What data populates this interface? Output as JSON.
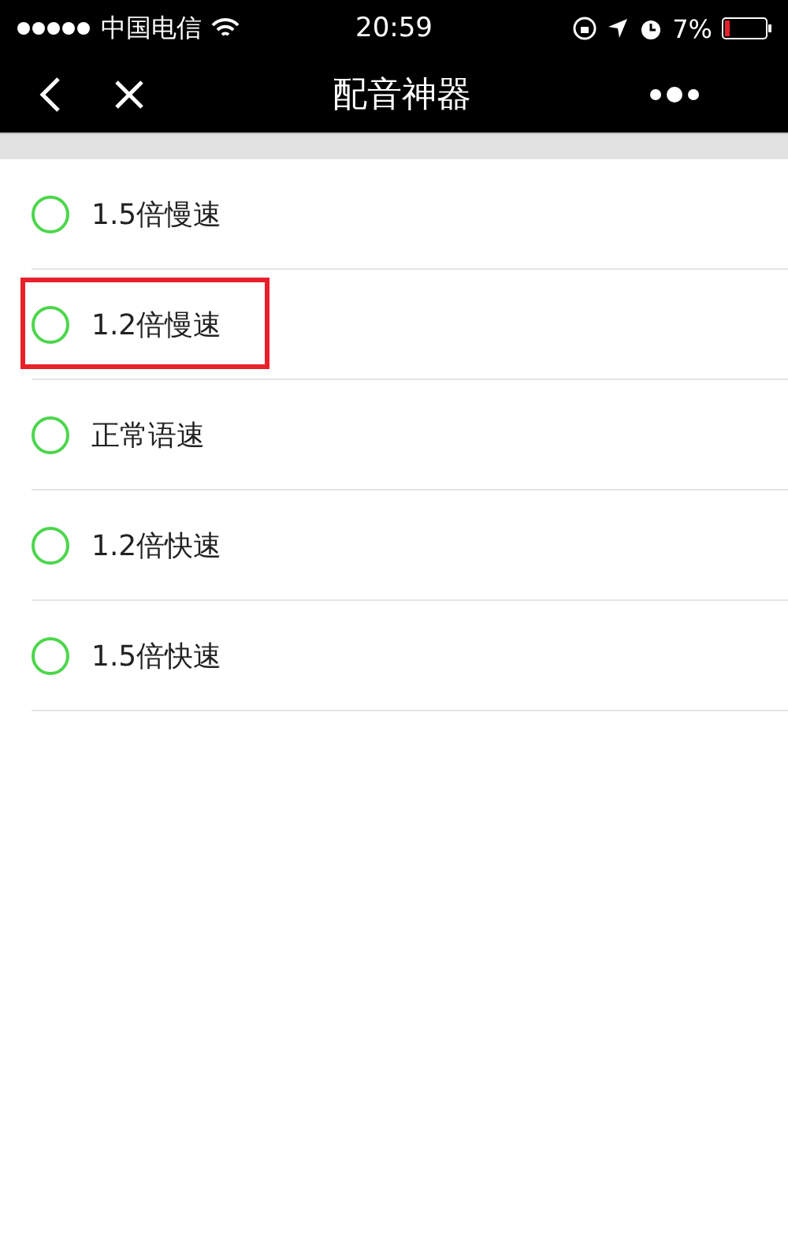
{
  "status_bar": {
    "carrier": "中国电信",
    "time": "20:59",
    "battery": "7%"
  },
  "nav": {
    "title": "配音神器"
  },
  "options": [
    {
      "label": "1.5倍慢速",
      "selected": false,
      "highlighted": false
    },
    {
      "label": "1.2倍慢速",
      "selected": false,
      "highlighted": true
    },
    {
      "label": "正常语速",
      "selected": false,
      "highlighted": false
    },
    {
      "label": "1.2倍快速",
      "selected": false,
      "highlighted": false
    },
    {
      "label": "1.5倍快速",
      "selected": false,
      "highlighted": false
    }
  ]
}
